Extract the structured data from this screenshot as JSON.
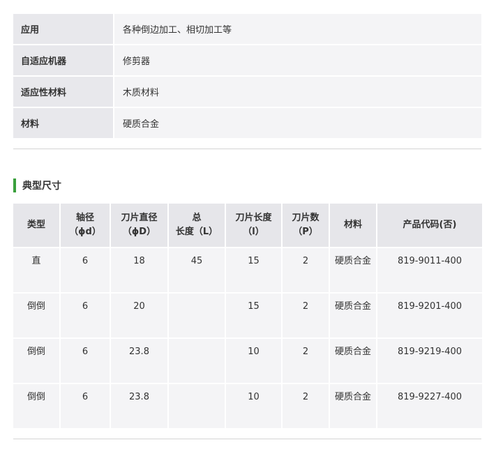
{
  "specs": [
    {
      "label": "应用",
      "value": "各种倒边加工、相切加工等"
    },
    {
      "label": "自适应机器",
      "value": "修剪器"
    },
    {
      "label": "适应性材料",
      "value": "木质材料"
    },
    {
      "label": "材料",
      "value": "硬质合金"
    }
  ],
  "section": {
    "title": "典型尺寸",
    "accent_color": "#3aa03c"
  },
  "dimensions": {
    "headers": [
      [
        "类型"
      ],
      [
        "轴径",
        "（ϕd）"
      ],
      [
        "刀片直径",
        "（ϕD）"
      ],
      [
        "总",
        "长度（L）"
      ],
      [
        "刀片长度",
        "（l）"
      ],
      [
        "刀片数",
        "（P）"
      ],
      [
        "材料"
      ],
      [
        "产品代码(否)"
      ]
    ],
    "rows": [
      [
        "直",
        "6",
        "18",
        "45",
        "15",
        "2",
        "硬质合金",
        "819-9011-400"
      ],
      [
        "倒倒",
        "6",
        "20",
        "",
        "15",
        "2",
        "硬质合金",
        "819-9201-400"
      ],
      [
        "倒倒",
        "6",
        "23.8",
        "",
        "10",
        "2",
        "硬质合金",
        "819-9219-400"
      ],
      [
        "倒倒",
        "6",
        "23.8",
        "",
        "10",
        "2",
        "硬质合金",
        "819-9227-400"
      ]
    ]
  }
}
